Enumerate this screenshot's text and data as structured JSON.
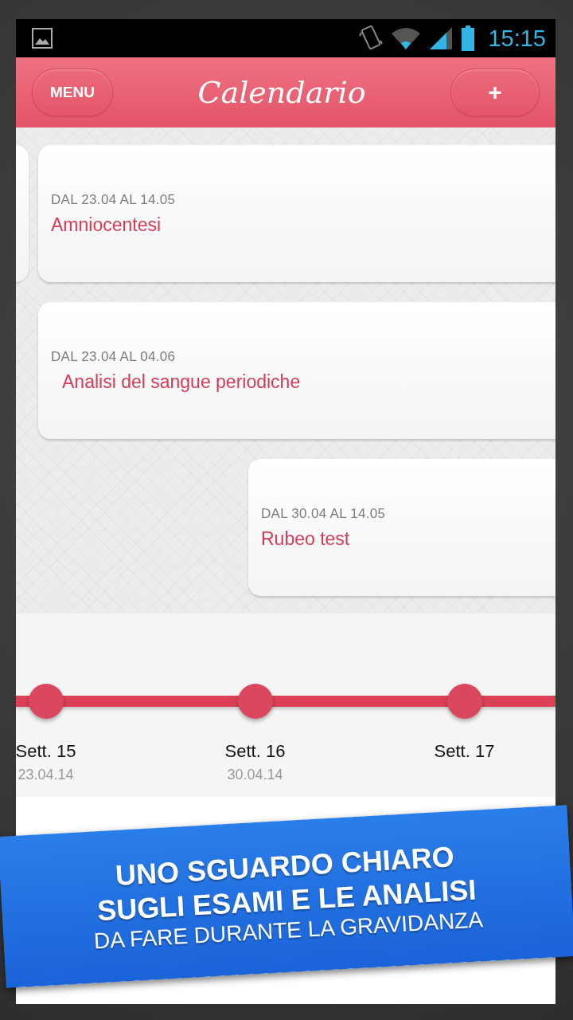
{
  "status_bar": {
    "time": "15:15"
  },
  "header": {
    "menu_button": "MENU",
    "title": "Calendario",
    "add_button": "+"
  },
  "events": [
    {
      "range": "DAL 23.04 AL 14.05",
      "title": "Amniocentesi",
      "kind": "wide"
    },
    {
      "range": "DAL 23.04 AL 04.06",
      "title": "Analisi del sangue periodiche",
      "kind": "wide"
    },
    {
      "range": "DAL 30.04 AL 14.05",
      "title": "Rubeo test",
      "kind": "short"
    }
  ],
  "timeline": [
    {
      "week": "Sett. 15",
      "date": "23.04.14"
    },
    {
      "week": "Sett. 16",
      "date": "30.04.14"
    },
    {
      "week": "Sett. 17"
    }
  ],
  "banner": {
    "headline": [
      "UNO SGUARDO CHIARO",
      "SUGLI ESAMI E LE ANALISI"
    ],
    "subline": "DA FARE DURANTE LA GRAVIDANZA"
  }
}
